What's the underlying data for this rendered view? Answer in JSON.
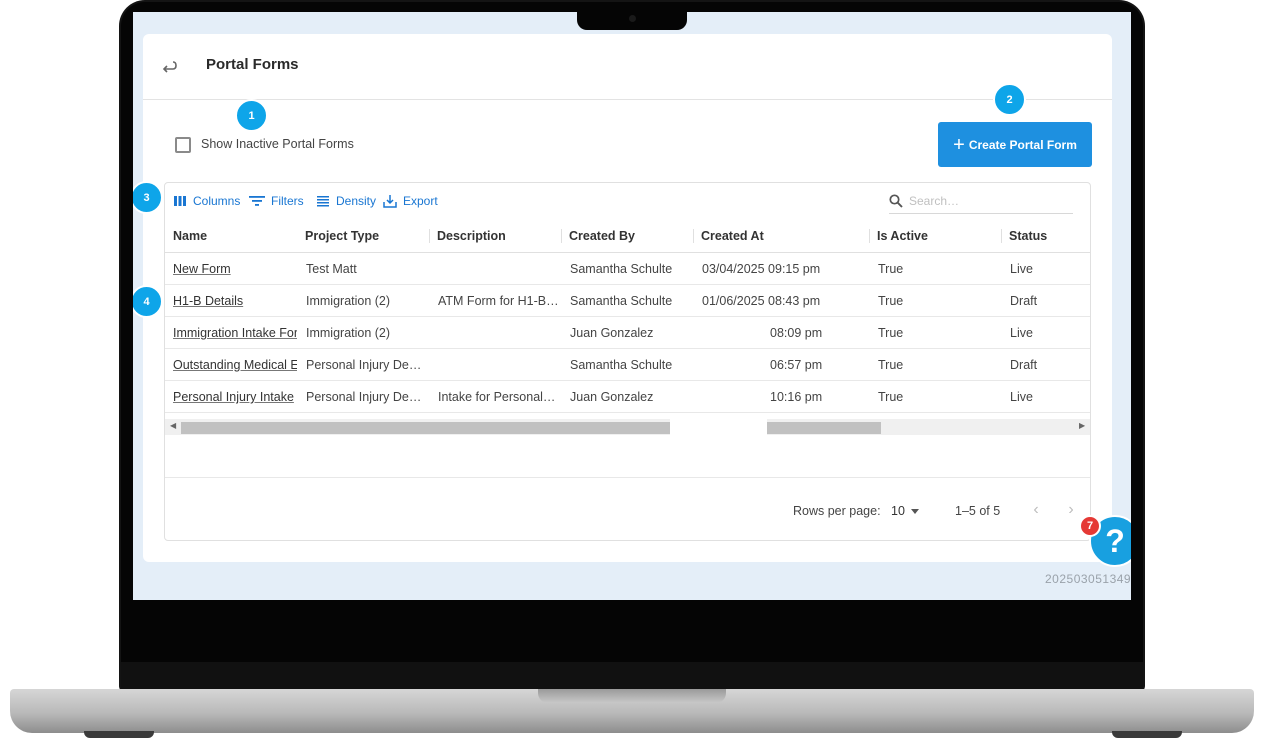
{
  "app": {
    "title": "Portal Forms",
    "version": "202503051349"
  },
  "callouts": [
    "1",
    "2",
    "3",
    "4"
  ],
  "filters": {
    "show_inactive_label": "Show Inactive Portal Forms",
    "show_inactive_checked": false
  },
  "actions": {
    "create_label": "Create Portal Form"
  },
  "toolbar": {
    "columns": "Columns",
    "filters": "Filters",
    "density": "Density",
    "export": "Export",
    "search_placeholder": "Search…"
  },
  "table": {
    "columns": [
      "Name",
      "Project Type",
      "Description",
      "Created By",
      "Created At",
      "Is Active",
      "Status"
    ],
    "rows": [
      [
        "New Form",
        "Test Matt",
        "",
        "Samantha Schulte",
        "03/04/2025 09:15 pm",
        "True",
        "Live"
      ],
      [
        "H1-B Details",
        "Immigration (2)",
        "ATM Form for H1-B…",
        "Samantha Schulte",
        "01/06/2025 08:43 pm",
        "True",
        "Draft"
      ],
      [
        "Immigration Intake For",
        "Immigration (2)",
        "",
        "Juan Gonzalez",
        "08:09 pm",
        "True",
        "Live"
      ],
      [
        "Outstanding Medical E",
        "Personal Injury De…",
        "",
        "Samantha Schulte",
        "06:57 pm",
        "True",
        "Draft"
      ],
      [
        "Personal Injury Intake",
        "Personal Injury De…",
        "Intake for Personal…",
        "Juan Gonzalez",
        "10:16 pm",
        "True",
        "Live"
      ]
    ]
  },
  "pagination": {
    "rows_per_page_label": "Rows per page:",
    "rows_per_page": "10",
    "range": "1–5 of 5"
  },
  "help": {
    "icon": "?",
    "badge_count": "7"
  },
  "colors": {
    "accent": "#1e90e0",
    "callout": "#0ea5e9",
    "link": "#1976d2",
    "badge": "#e53935"
  }
}
